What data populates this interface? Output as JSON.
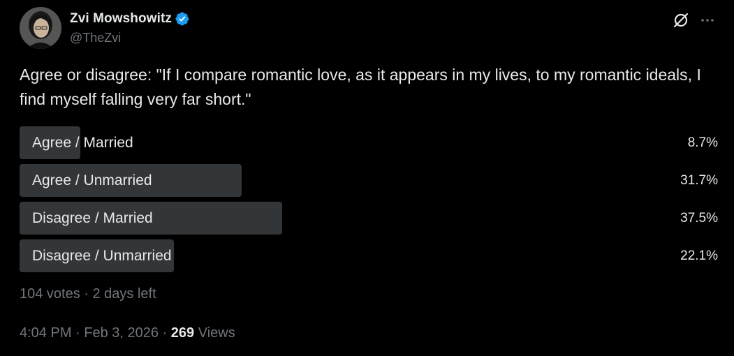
{
  "author": {
    "display_name": "Zvi Mowshowitz",
    "handle": "@TheZvi",
    "verified": true,
    "verified_color": "#1d9bf0"
  },
  "header_actions": {
    "grok_icon": "grok-icon",
    "more_icon": "more-horizontal-icon",
    "more_label": "···"
  },
  "tweet": {
    "text": "Agree or disagree: \"If I compare romantic love, as it appears in my lives, to my romantic ideals, I find myself falling very far short.\""
  },
  "poll": {
    "options": [
      {
        "label": "Agree / Married",
        "percent_text": "8.7%",
        "percent": 8.7
      },
      {
        "label": "Agree / Unmarried",
        "percent_text": "31.7%",
        "percent": 31.7
      },
      {
        "label": "Disagree / Married",
        "percent_text": "37.5%",
        "percent": 37.5
      },
      {
        "label": "Disagree / Unmarried",
        "percent_text": "22.1%",
        "percent": 22.1
      }
    ],
    "meta": "104 votes · 2 days left"
  },
  "footer": {
    "time_date": "4:04 PM · Feb 3, 2026 · ",
    "views_count": "269",
    "views_label": " Views"
  },
  "colors": {
    "background": "#000000",
    "text_primary": "#e7e9ea",
    "text_secondary": "#71767b",
    "poll_bar": "#333639"
  }
}
